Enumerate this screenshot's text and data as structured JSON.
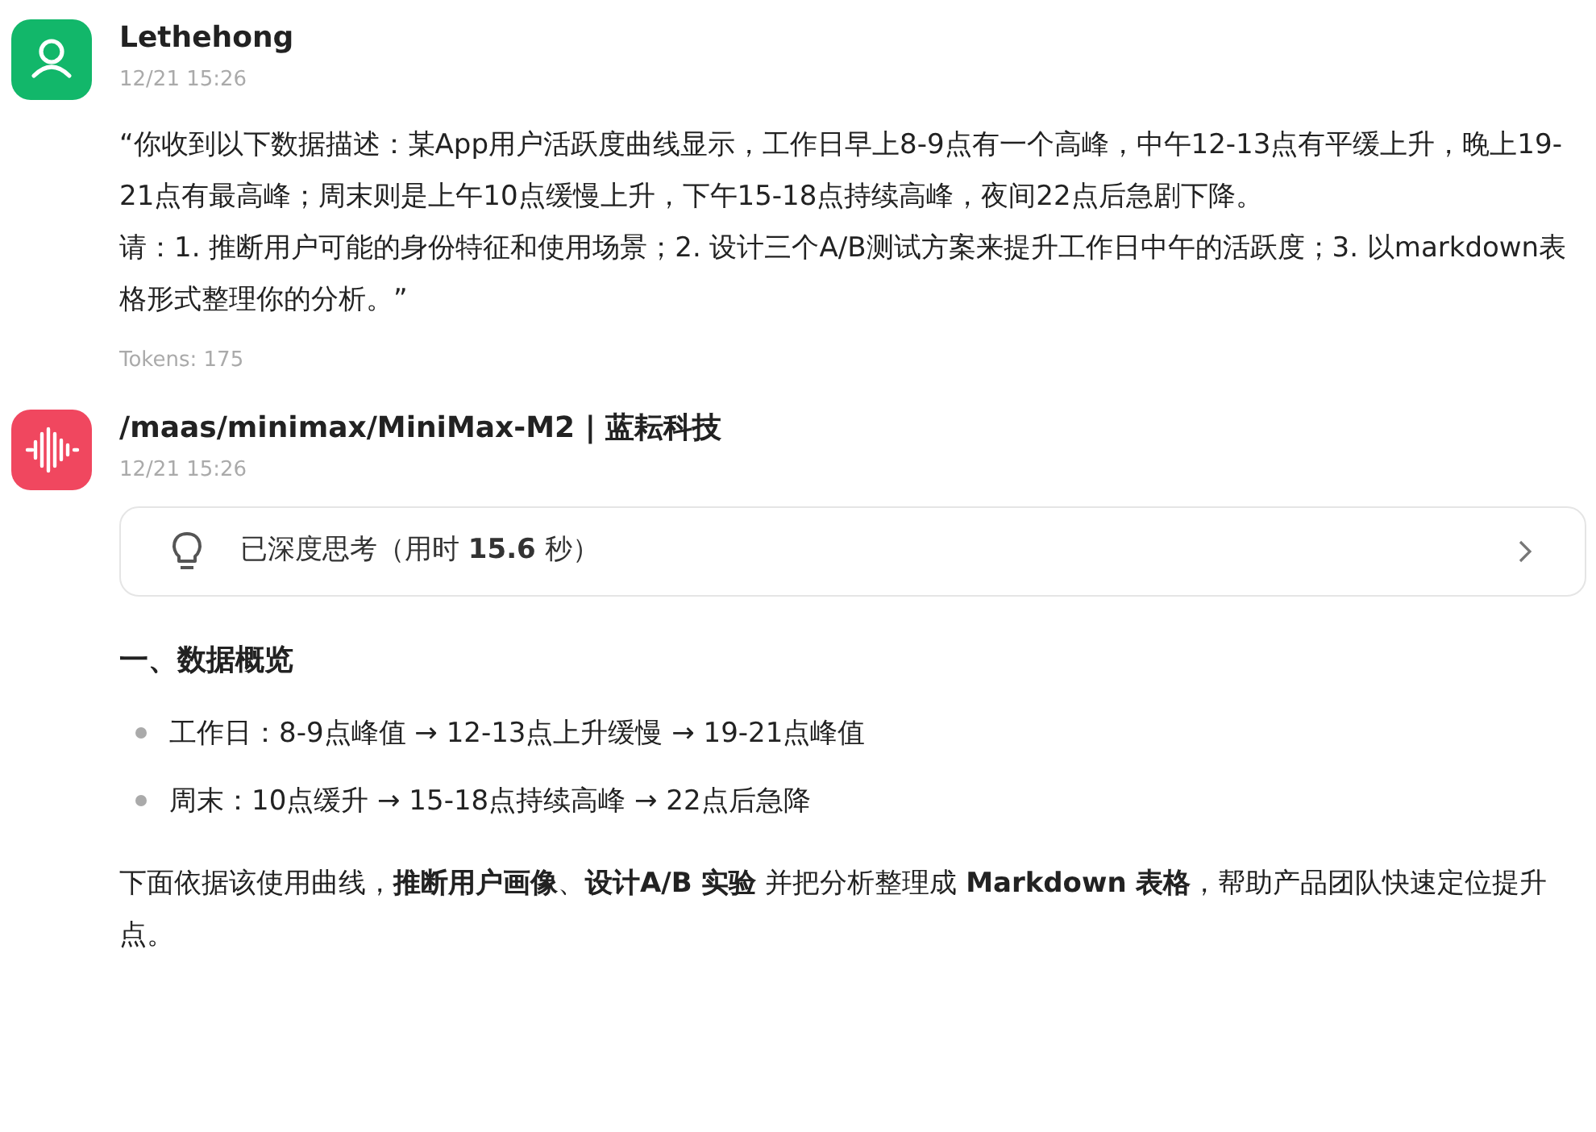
{
  "messages": [
    {
      "kind": "user",
      "author": "Lethehong",
      "time": "12/21 15:26",
      "paragraphs": [
        "“你收到以下数据描述：某App用户活跃度曲线显示，工作日早上8-9点有一个高峰，中午12-13点有平缓上升，晚上19-21点有最高峰；周末则是上午10点缓慢上升，下午15-18点持续高峰，夜间22点后急剧下降。",
        "请：1. 推断用户可能的身份特征和使用场景；2. 设计三个A/B测试方案来提升工作日中午的活跃度；3. 以markdown表格形式整理你的分析。”"
      ],
      "tokens": "Tokens: 175"
    },
    {
      "kind": "bot",
      "author": "/maas/minimax/MiniMax-M2 | 蓝耘科技",
      "time": "12/21 15:26",
      "thinking": {
        "label": "已深度思考（用时 **15.6** 秒）",
        "expanded": false
      },
      "heading": "一、数据概览",
      "bullets": [
        "工作日：8-9点峰值 → 12-13点上升缓慢 → 19-21点峰值",
        "周末：10点缓升 → 15-18点持续高峰 → 22点后急降"
      ],
      "paragraphs": [
        "下面依据该使用曲线，**推断用户画像**、**设计A/B 实验** 并把分析整理成 **Markdown 表格**，帮助产品团队快速定位提升点。"
      ]
    }
  ]
}
